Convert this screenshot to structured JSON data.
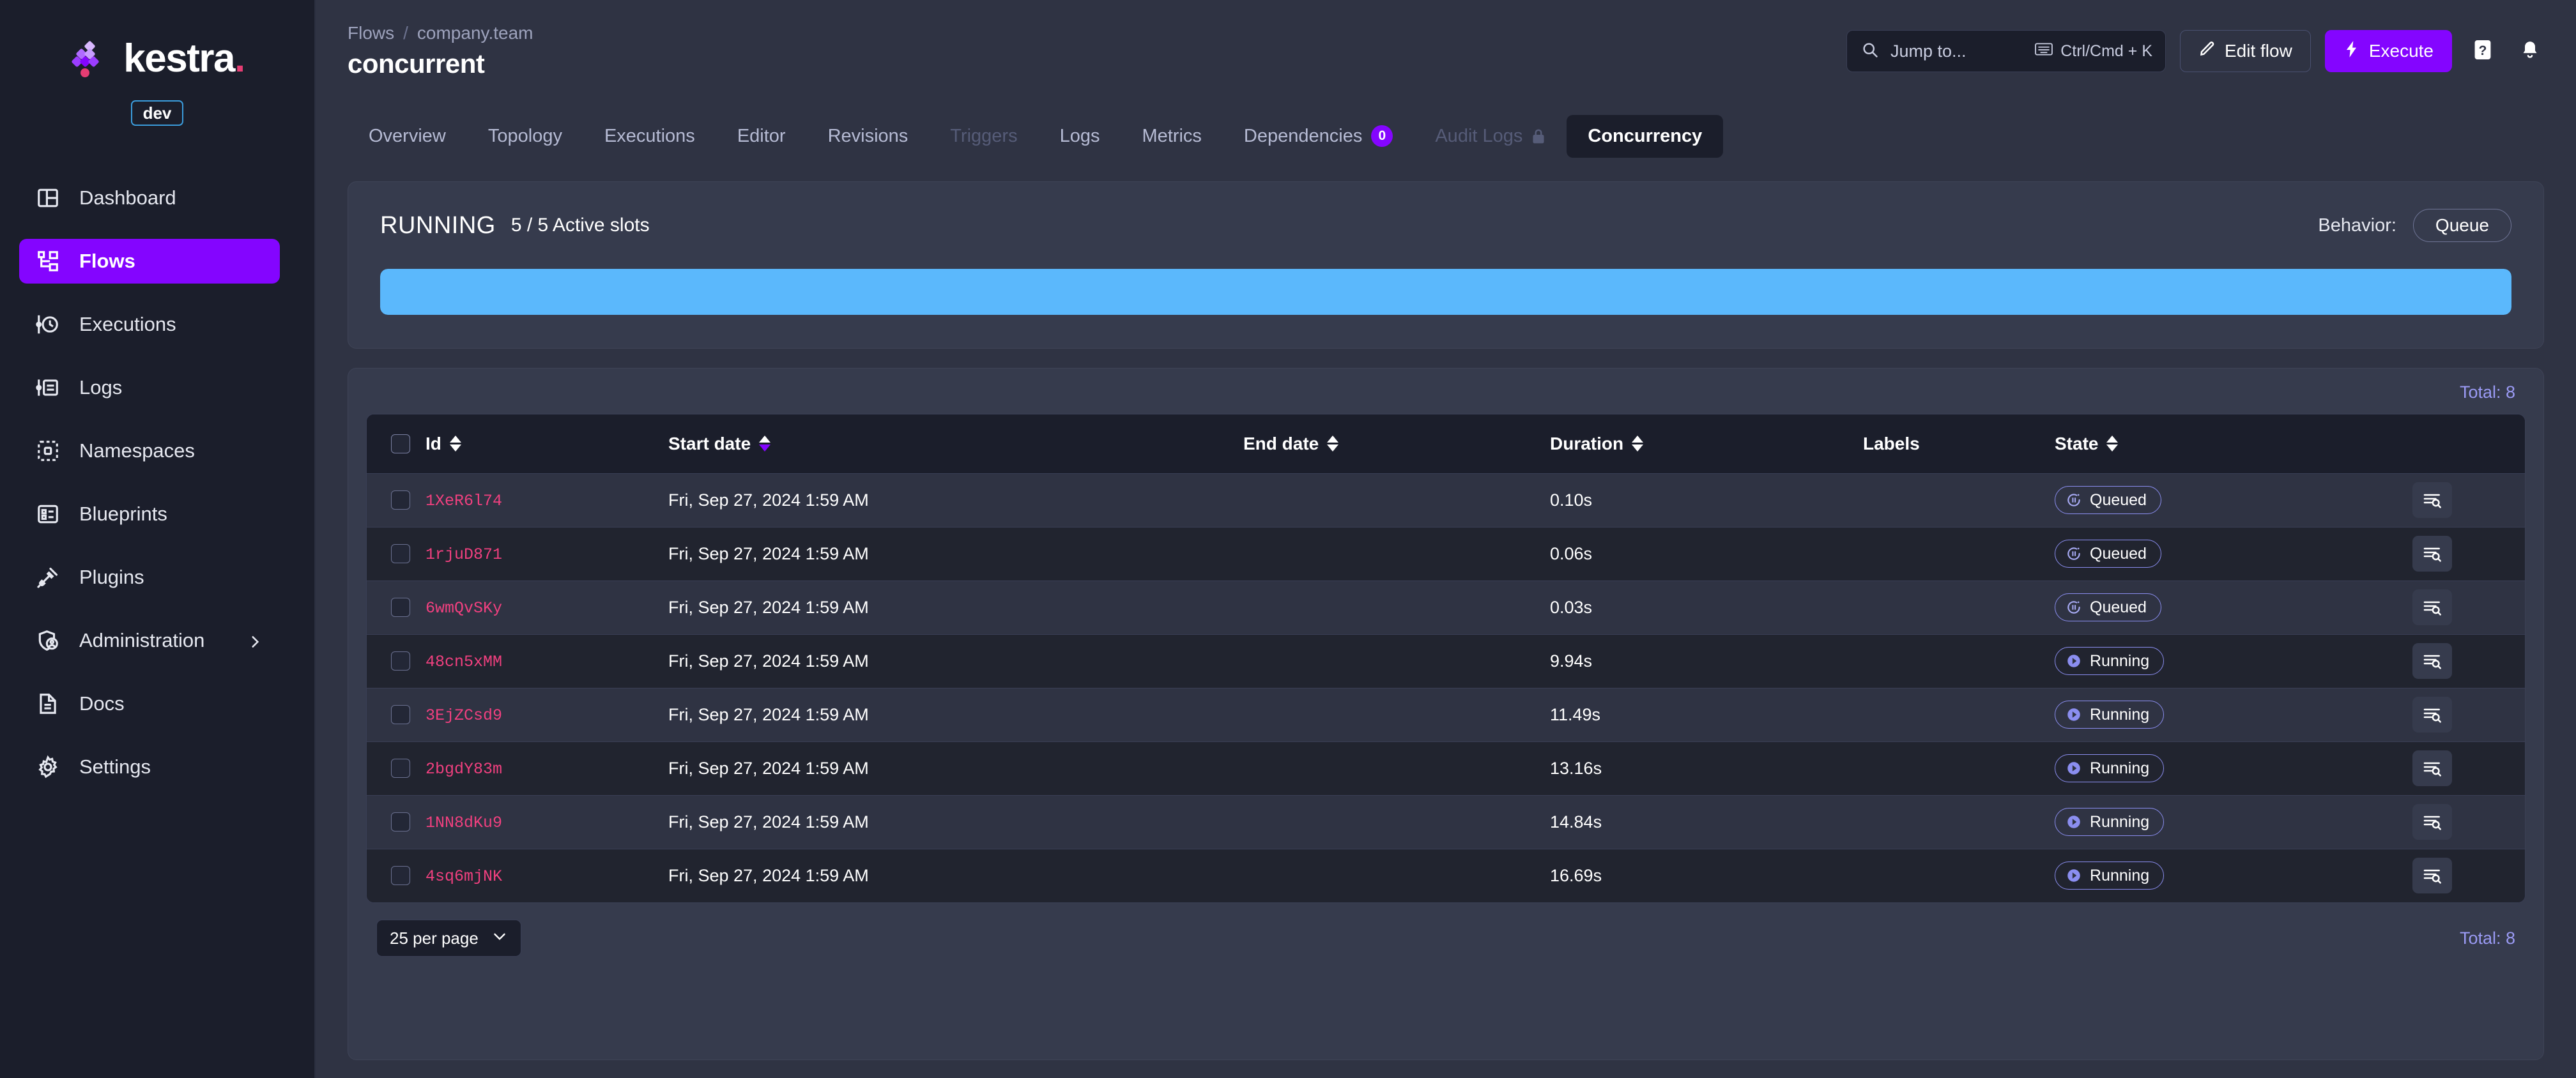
{
  "brand": {
    "name": "kestra",
    "dot": ".",
    "env_badge": "dev",
    "accent_purple": "#8405FF",
    "accent_pink": "#E53D73"
  },
  "sidebar": {
    "items": [
      {
        "label": "Dashboard",
        "icon": "dashboard-icon",
        "active": false
      },
      {
        "label": "Flows",
        "icon": "flows-icon",
        "active": true
      },
      {
        "label": "Executions",
        "icon": "executions-icon",
        "active": false
      },
      {
        "label": "Logs",
        "icon": "logs-icon",
        "active": false
      },
      {
        "label": "Namespaces",
        "icon": "namespaces-icon",
        "active": false
      },
      {
        "label": "Blueprints",
        "icon": "blueprints-icon",
        "active": false
      },
      {
        "label": "Plugins",
        "icon": "plugins-icon",
        "active": false
      },
      {
        "label": "Administration",
        "icon": "administration-icon",
        "active": false,
        "has_chevron": true
      },
      {
        "label": "Docs",
        "icon": "docs-icon",
        "active": false
      },
      {
        "label": "Settings",
        "icon": "settings-icon",
        "active": false
      }
    ]
  },
  "header": {
    "breadcrumb": {
      "root": "Flows",
      "separator": "/",
      "namespace": "company.team"
    },
    "title": "concurrent",
    "search": {
      "placeholder": "Jump to...",
      "shortcut": "Ctrl/Cmd + K",
      "icon": "search-icon",
      "keyboard_icon": "keyboard-icon"
    },
    "edit_flow_label": "Edit flow",
    "execute_label": "Execute",
    "help_icon": "question-mark-icon",
    "bell_icon": "bell-icon"
  },
  "tabs": [
    {
      "label": "Overview",
      "state": "normal"
    },
    {
      "label": "Topology",
      "state": "normal"
    },
    {
      "label": "Executions",
      "state": "normal"
    },
    {
      "label": "Editor",
      "state": "normal"
    },
    {
      "label": "Revisions",
      "state": "normal"
    },
    {
      "label": "Triggers",
      "state": "disabled"
    },
    {
      "label": "Logs",
      "state": "normal"
    },
    {
      "label": "Metrics",
      "state": "normal"
    },
    {
      "label": "Dependencies",
      "state": "normal",
      "badge": "0"
    },
    {
      "label": "Audit Logs",
      "state": "disabled",
      "locked": true
    },
    {
      "label": "Concurrency",
      "state": "active"
    }
  ],
  "running_panel": {
    "status_label": "RUNNING",
    "slots_text": "5 / 5 Active slots",
    "behavior_label": "Behavior:",
    "behavior_value": "Queue",
    "progress_percent": 100,
    "progress_color": "#5BB8FC"
  },
  "table": {
    "total_top": "Total: 8",
    "total_bottom": "Total: 8",
    "per_page": "25 per page",
    "columns": [
      {
        "label": "Id",
        "sortable": true,
        "sort": "none"
      },
      {
        "label": "Start date",
        "sortable": true,
        "sort": "asc"
      },
      {
        "label": "End date",
        "sortable": true,
        "sort": "none"
      },
      {
        "label": "Duration",
        "sortable": true,
        "sort": "none"
      },
      {
        "label": "Labels",
        "sortable": false
      },
      {
        "label": "State",
        "sortable": true,
        "sort": "none"
      }
    ],
    "rows": [
      {
        "id": "1XeR6l74",
        "start_date": "Fri, Sep 27, 2024 1:59 AM",
        "end_date": "",
        "duration": "0.10s",
        "labels": "",
        "state": "Queued"
      },
      {
        "id": "1rjuD871",
        "start_date": "Fri, Sep 27, 2024 1:59 AM",
        "end_date": "",
        "duration": "0.06s",
        "labels": "",
        "state": "Queued"
      },
      {
        "id": "6wmQvSKy",
        "start_date": "Fri, Sep 27, 2024 1:59 AM",
        "end_date": "",
        "duration": "0.03s",
        "labels": "",
        "state": "Queued"
      },
      {
        "id": "48cn5xMM",
        "start_date": "Fri, Sep 27, 2024 1:59 AM",
        "end_date": "",
        "duration": "9.94s",
        "labels": "",
        "state": "Running"
      },
      {
        "id": "3EjZCsd9",
        "start_date": "Fri, Sep 27, 2024 1:59 AM",
        "end_date": "",
        "duration": "11.49s",
        "labels": "",
        "state": "Running"
      },
      {
        "id": "2bgdY83m",
        "start_date": "Fri, Sep 27, 2024 1:59 AM",
        "end_date": "",
        "duration": "13.16s",
        "labels": "",
        "state": "Running"
      },
      {
        "id": "1NN8dKu9",
        "start_date": "Fri, Sep 27, 2024 1:59 AM",
        "end_date": "",
        "duration": "14.84s",
        "labels": "",
        "state": "Running"
      },
      {
        "id": "4sq6mjNK",
        "start_date": "Fri, Sep 27, 2024 1:59 AM",
        "end_date": "",
        "duration": "16.69s",
        "labels": "",
        "state": "Running"
      }
    ],
    "row_action_icon": "log-search-icon"
  }
}
